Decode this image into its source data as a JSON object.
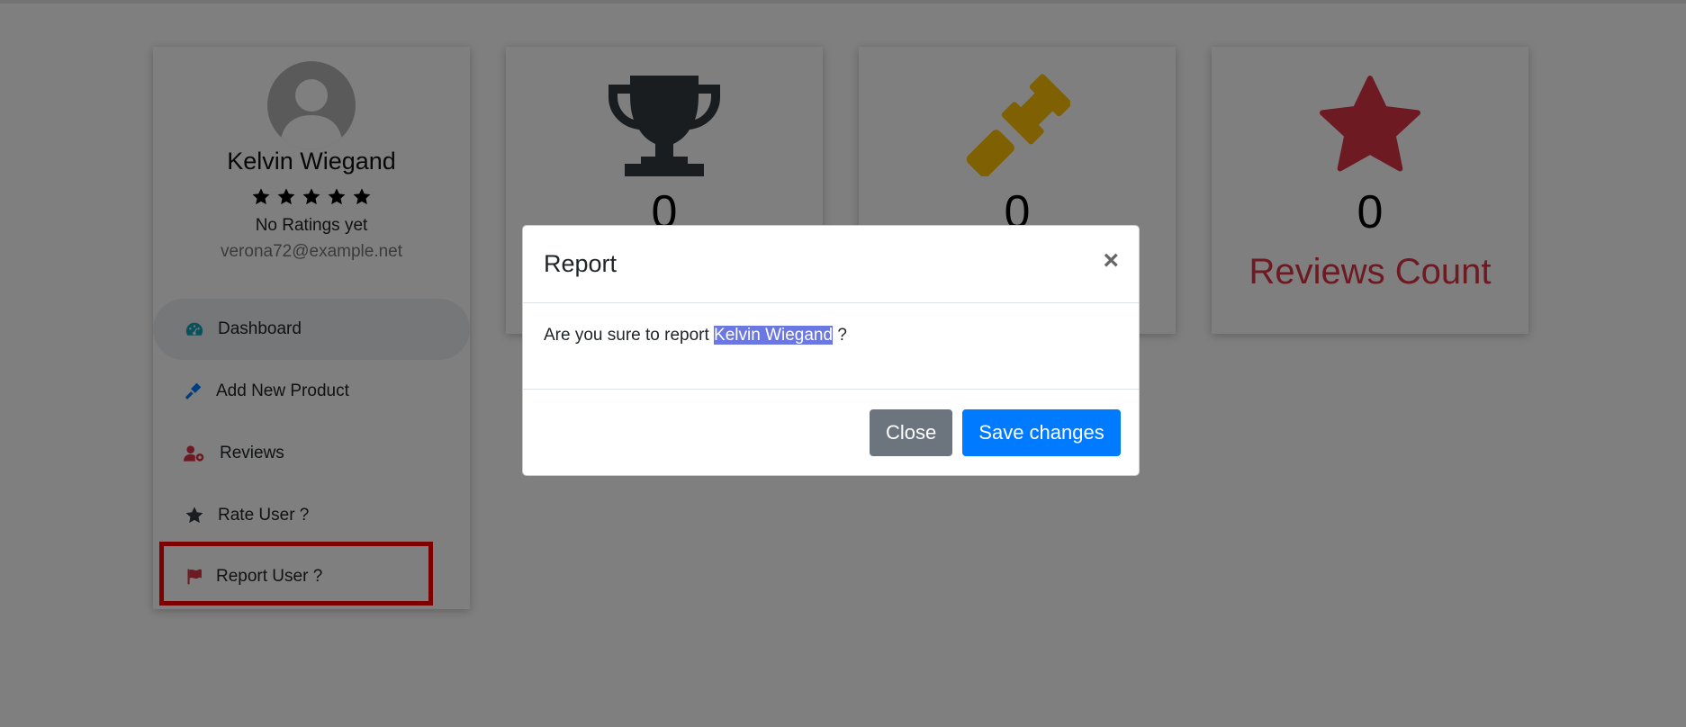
{
  "profile": {
    "name": "Kelvin Wiegand",
    "stars": [
      "star-icon",
      "star-icon",
      "star-icon",
      "star-icon",
      "star-icon"
    ],
    "ratings_text": "No Ratings yet",
    "email": "verona72@example.net"
  },
  "menu": {
    "items": [
      {
        "label": "Dashboard",
        "icon": "tachometer-icon",
        "color": "#17a2b8"
      },
      {
        "label": "Add New Product",
        "icon": "gavel-icon",
        "color": "#007bff"
      },
      {
        "label": "Reviews",
        "icon": "user-cog-icon",
        "color": "#dc3545"
      },
      {
        "label": "Rate User ?",
        "icon": "star-icon",
        "color": "#343a40"
      },
      {
        "label": "Report User ?",
        "icon": "flag-icon",
        "color": "#dc3545"
      }
    ]
  },
  "stats": [
    {
      "icon": "trophy-icon",
      "value": "0",
      "label": "",
      "color": "#343a40"
    },
    {
      "icon": "gavel-icon",
      "value": "0",
      "label": "",
      "color": "#ffc107"
    },
    {
      "icon": "star-icon",
      "value": "0",
      "label": "Reviews Count",
      "color": "#dc3545"
    }
  ],
  "modal": {
    "title": "Report",
    "close_symbol": "×",
    "text_prefix": "Are you sure to report",
    "target_name": "Kelvin Wiegand",
    "text_suffix": "?",
    "close_label": "Close",
    "save_label": "Save changes"
  },
  "colors": {
    "primary": "#007bff",
    "secondary": "#6c757d",
    "danger": "#dc3545",
    "warning": "#ffc107",
    "highlight": "#6b78e2"
  }
}
